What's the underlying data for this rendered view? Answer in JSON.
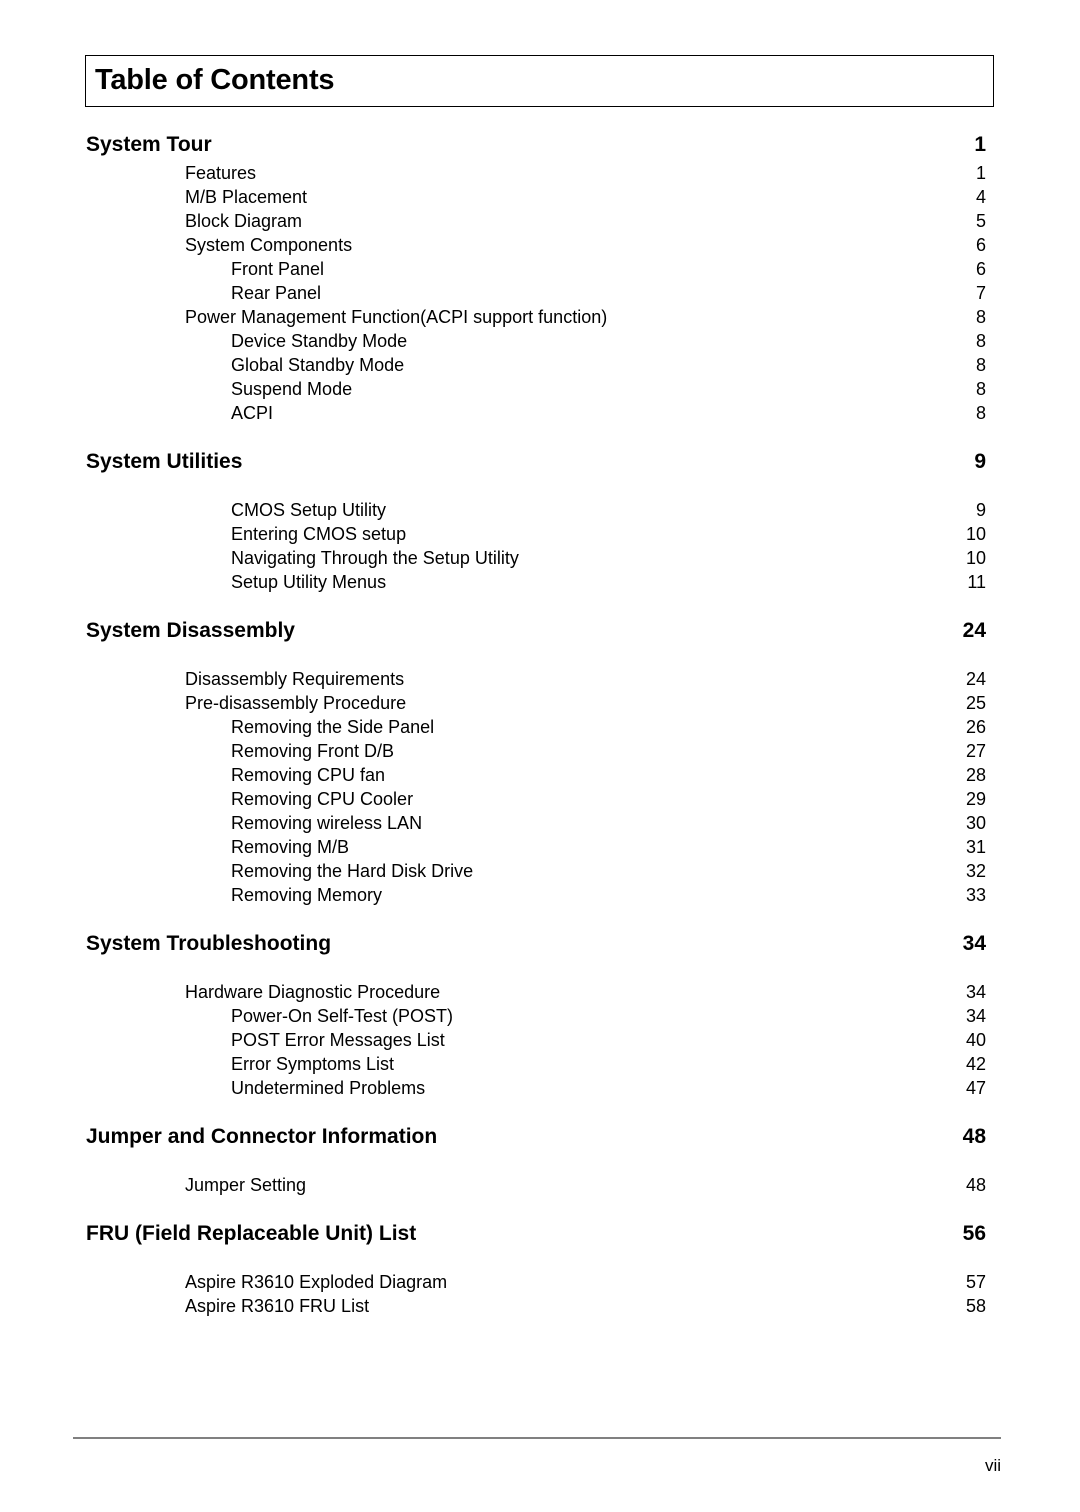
{
  "document": {
    "title": "Table of Contents",
    "footer_page_number": "vii"
  },
  "toc": {
    "entries": [
      {
        "level": 0,
        "label": "System Tour",
        "page": "1",
        "gap_before": false
      },
      {
        "level": 1,
        "label": "Features",
        "page": "1",
        "gap_before": false
      },
      {
        "level": 1,
        "label": "M/B Placement",
        "page": "4",
        "gap_before": false
      },
      {
        "level": 1,
        "label": "Block Diagram",
        "page": "5",
        "gap_before": false
      },
      {
        "level": 1,
        "label": "System Components",
        "page": "6",
        "gap_before": false
      },
      {
        "level": 2,
        "label": "Front Panel",
        "page": "6",
        "gap_before": false
      },
      {
        "level": 2,
        "label": "Rear Panel",
        "page": "7",
        "gap_before": false
      },
      {
        "level": 1,
        "label": "Power Management Function(ACPI support function)",
        "page": "8",
        "gap_before": false
      },
      {
        "level": 2,
        "label": "Device Standby Mode",
        "page": "8",
        "gap_before": false
      },
      {
        "level": 2,
        "label": "Global Standby Mode",
        "page": "8",
        "gap_before": false
      },
      {
        "level": 2,
        "label": "Suspend Mode",
        "page": "8",
        "gap_before": false
      },
      {
        "level": 2,
        "label": "ACPI",
        "page": "8",
        "gap_before": false
      },
      {
        "level": 0,
        "label": "System Utilities",
        "page": "9",
        "gap_before": true
      },
      {
        "level": 2,
        "label": "CMOS Setup Utility",
        "page": "9",
        "gap_before": true
      },
      {
        "level": 2,
        "label": "Entering CMOS setup",
        "page": "10",
        "gap_before": false
      },
      {
        "level": 2,
        "label": "Navigating Through the Setup Utility",
        "page": "10",
        "gap_before": false
      },
      {
        "level": 2,
        "label": "Setup Utility Menus",
        "page": "11",
        "gap_before": false
      },
      {
        "level": 0,
        "label": "System Disassembly",
        "page": "24",
        "gap_before": true
      },
      {
        "level": 1,
        "label": "Disassembly Requirements",
        "page": "24",
        "gap_before": true
      },
      {
        "level": 1,
        "label": "Pre-disassembly Procedure",
        "page": "25",
        "gap_before": false
      },
      {
        "level": 2,
        "label": "Removing the Side Panel",
        "page": "26",
        "gap_before": false
      },
      {
        "level": 2,
        "label": "Removing Front D/B",
        "page": "27",
        "gap_before": false
      },
      {
        "level": 2,
        "label": "Removing CPU fan",
        "page": "28",
        "gap_before": false
      },
      {
        "level": 2,
        "label": "Removing CPU Cooler",
        "page": "29",
        "gap_before": false
      },
      {
        "level": 2,
        "label": "Removing wireless LAN",
        "page": "30",
        "gap_before": false
      },
      {
        "level": 2,
        "label": "Removing M/B",
        "page": "31",
        "gap_before": false
      },
      {
        "level": 2,
        "label": "Removing the Hard Disk Drive",
        "page": "32",
        "gap_before": false
      },
      {
        "level": 2,
        "label": "Removing Memory",
        "page": "33",
        "gap_before": false
      },
      {
        "level": 0,
        "label": "System Troubleshooting",
        "page": "34",
        "gap_before": true
      },
      {
        "level": 1,
        "label": "Hardware Diagnostic Procedure",
        "page": "34",
        "gap_before": true
      },
      {
        "level": 2,
        "label": "Power-On Self-Test (POST)",
        "page": "34",
        "gap_before": false
      },
      {
        "level": 2,
        "label": "POST Error Messages List",
        "page": "40",
        "gap_before": false
      },
      {
        "level": 2,
        "label": "Error Symptoms List",
        "page": "42",
        "gap_before": false
      },
      {
        "level": 2,
        "label": "Undetermined Problems",
        "page": "47",
        "gap_before": false
      },
      {
        "level": 0,
        "label": "Jumper and Connector Information",
        "page": "48",
        "gap_before": true
      },
      {
        "level": 1,
        "label": "Jumper Setting",
        "page": "48",
        "gap_before": true
      },
      {
        "level": 0,
        "label": "FRU (Field Replaceable Unit) List",
        "page": "56",
        "gap_before": true
      },
      {
        "level": 1,
        "label": "Aspire R3610 Exploded Diagram",
        "page": "57",
        "gap_before": true
      },
      {
        "level": 1,
        "label": "Aspire R3610 FRU List",
        "page": "58",
        "gap_before": false
      }
    ]
  }
}
